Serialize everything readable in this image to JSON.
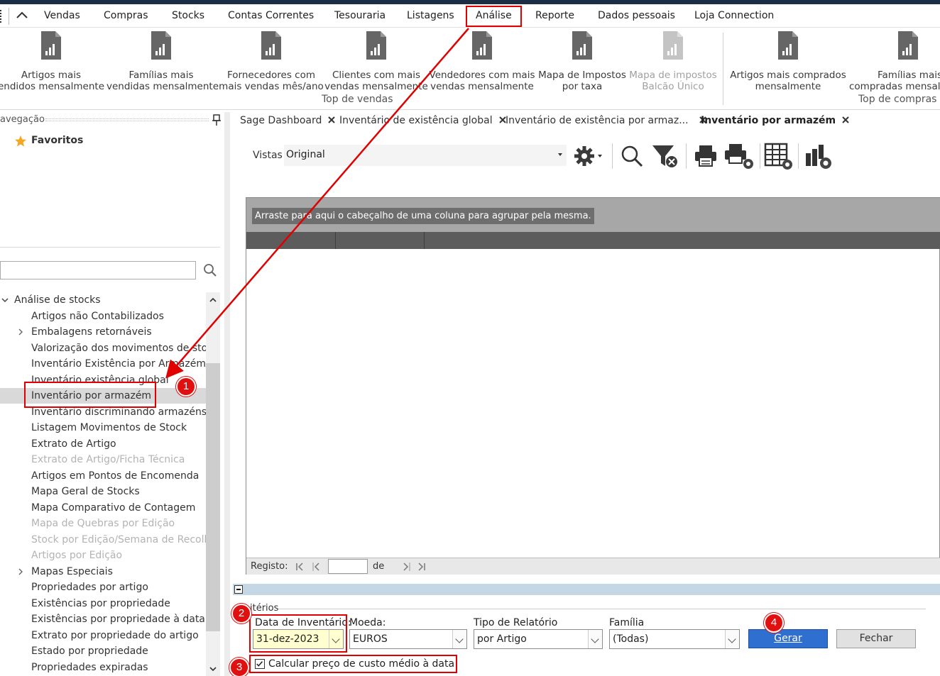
{
  "menu": {
    "items": [
      "Vendas",
      "Compras",
      "Stocks",
      "Contas Correntes",
      "Tesouraria",
      "Listagens",
      "Análise",
      "Reporte",
      "Dados pessoais",
      "Loja Connection"
    ]
  },
  "ribbon": {
    "buttons": [
      {
        "line1": "Artigos mais",
        "line2": "endidos mensalmente",
        "disabled": false
      },
      {
        "line1": "Famílias mais",
        "line2": "vendidas mensalmente",
        "disabled": false
      },
      {
        "line1": "Fornecedores com",
        "line2": "mais vendas mês/ano",
        "disabled": false
      },
      {
        "line1": "Clientes com mais",
        "line2": "vendas mensalmente",
        "disabled": false
      },
      {
        "line1": "Vendedores com mais",
        "line2": "vendas mensalmente",
        "disabled": false
      },
      {
        "line1": "Mapa de Impostos",
        "line2": "por taxa",
        "disabled": false
      },
      {
        "line1": "Mapa de impostos",
        "line2": "Balcão Único",
        "disabled": true
      },
      {
        "line1": "Artigos mais comprados",
        "line2": "mensalmente",
        "disabled": false
      },
      {
        "line1": "Famílias mais",
        "line2": "compradas mensalm",
        "disabled": false
      }
    ],
    "group_sales": "Top de vendas",
    "group_purchases": "Top de compras"
  },
  "nav": {
    "header": "avegação",
    "favorites": "Favoritos",
    "search_value": "",
    "tree": [
      {
        "label": "Análise de stocks",
        "kind": "root"
      },
      {
        "label": "Artigos não Contabilizados",
        "kind": "item"
      },
      {
        "label": "Embalagens retornáveis",
        "kind": "expandable"
      },
      {
        "label": "Valorização dos movimentos de stock",
        "kind": "item"
      },
      {
        "label": "Inventário Existência por Armazém",
        "kind": "item"
      },
      {
        "label": "Inventário existência global",
        "kind": "item"
      },
      {
        "label": "Inventário por armazém",
        "kind": "selected"
      },
      {
        "label": "Inventário discriminando armazéns",
        "kind": "item"
      },
      {
        "label": "Listagem Movimentos de Stock",
        "kind": "item"
      },
      {
        "label": "Extrato de Artigo",
        "kind": "item"
      },
      {
        "label": "Extrato de Artigo/Ficha Técnica",
        "kind": "disabled"
      },
      {
        "label": "Artigos em Pontos de Encomenda",
        "kind": "item"
      },
      {
        "label": "Mapa Geral de Stocks",
        "kind": "item"
      },
      {
        "label": "Mapa Comparativo de Contagem",
        "kind": "item"
      },
      {
        "label": "Mapa de Quebras por Edição",
        "kind": "disabled"
      },
      {
        "label": "Stock por Edição/Semana de Recolha",
        "kind": "disabled"
      },
      {
        "label": "Artigos por Edição",
        "kind": "disabled"
      },
      {
        "label": "Mapas Especiais",
        "kind": "expandable"
      },
      {
        "label": "Propriedades por artigo",
        "kind": "item"
      },
      {
        "label": "Existências por propriedade",
        "kind": "item"
      },
      {
        "label": "Existências por propriedade à data",
        "kind": "item"
      },
      {
        "label": "Extrato por propriedade do artigo",
        "kind": "item"
      },
      {
        "label": "Estado por propriedade",
        "kind": "item"
      },
      {
        "label": "Propriedades expiradas",
        "kind": "item"
      }
    ]
  },
  "tabs": [
    "Sage Dashboard",
    "Inventário de existência global",
    "Inventário de existência por armaz...",
    "Inventário por armazém"
  ],
  "toolbar": {
    "vistas_label": "Vistas",
    "vistas_value": "Original"
  },
  "grid": {
    "group_hint": "Arraste para aqui o cabeçalho de uma coluna para agrupar pela mesma.",
    "record_label": "Registo:",
    "record_value": "",
    "of_label": "de"
  },
  "criteria": {
    "legend": "itérios",
    "date_label": "Data de Inventário:",
    "date_value": "31-dez-2023",
    "currency_label": "Moeda:",
    "currency_value": "EUROS",
    "report_type_label": "Tipo de Relatório",
    "report_type_value": "por Artigo",
    "family_label": "Família",
    "family_value": "(Todas)",
    "generate_label": "Gerar",
    "close_label": "Fechar",
    "avg_cost_label": "Calcular preço de custo médio à data",
    "avg_cost_checked": true
  },
  "annotations": {
    "badges": [
      "1",
      "2",
      "3",
      "4"
    ],
    "color": "#e00000"
  },
  "colors": {
    "accent_button": "#2f6fd0",
    "date_field_bg": "#ffffd0",
    "selected_row": "#d9d9d9",
    "grid_group_panel": "#a7a7a7",
    "grid_header": "#5c5c5c"
  }
}
